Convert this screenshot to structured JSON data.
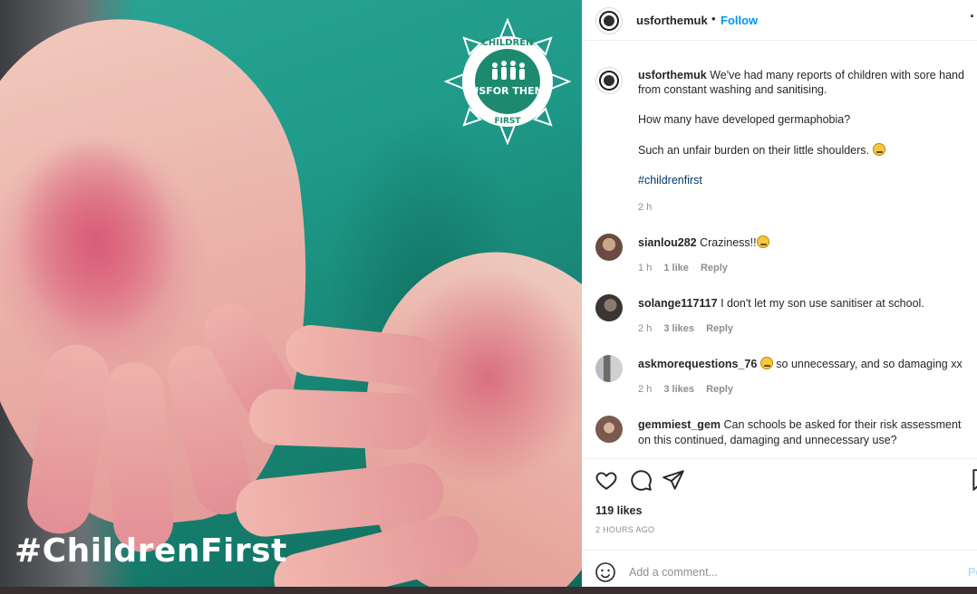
{
  "photo": {
    "hashtag": "#ChildrenFirst",
    "logo": {
      "top_text": "CHILDREN",
      "middle_text": "USFOR THEM",
      "bottom_text": "FIRST"
    }
  },
  "header": {
    "username": "usforthemuk",
    "separator": "•",
    "follow_label": "Follow",
    "more_icon": "more-options-icon",
    "more_glyph": "·"
  },
  "caption": {
    "username": "usforthemuk",
    "line1": "We've had many reports of children with sore hand",
    "line2": "from constant washing and sanitising.",
    "line3": "How many have developed germaphobia?",
    "line4": "Such an unfair burden on their little shoulders.",
    "hashtag": "#childrenfirst",
    "time": "2 h"
  },
  "comments": [
    {
      "username": "sianlou282",
      "text": "Craziness!!",
      "time": "1 h",
      "likes": "1 like",
      "reply": "Reply",
      "avatar_color": "#6b4a3f"
    },
    {
      "username": "solange117117",
      "text": "I don't let my son use sanitiser at school.",
      "time": "2 h",
      "likes": "3 likes",
      "reply": "Reply",
      "avatar_color": "#3a3533"
    },
    {
      "username": "askmorequestions_76",
      "text": "so unnecessary, and so damaging xx",
      "time": "2 h",
      "likes": "3 likes",
      "reply": "Reply",
      "avatar_color": "#8a8f95"
    },
    {
      "username": "gemmiest_gem",
      "text": "Can schools be asked for their risk assessment",
      "text2": "on this continued, damaging and unnecessary use?",
      "avatar_color": "#7a5a4c"
    }
  ],
  "actions": {
    "like_icon": "heart-icon",
    "comment_icon": "comment-icon",
    "share_icon": "share-icon",
    "save_icon": "bookmark-icon"
  },
  "likes": "119 likes",
  "posted": "2 HOURS AGO",
  "add_comment": {
    "placeholder": "Add a comment...",
    "post_label": "Po"
  }
}
